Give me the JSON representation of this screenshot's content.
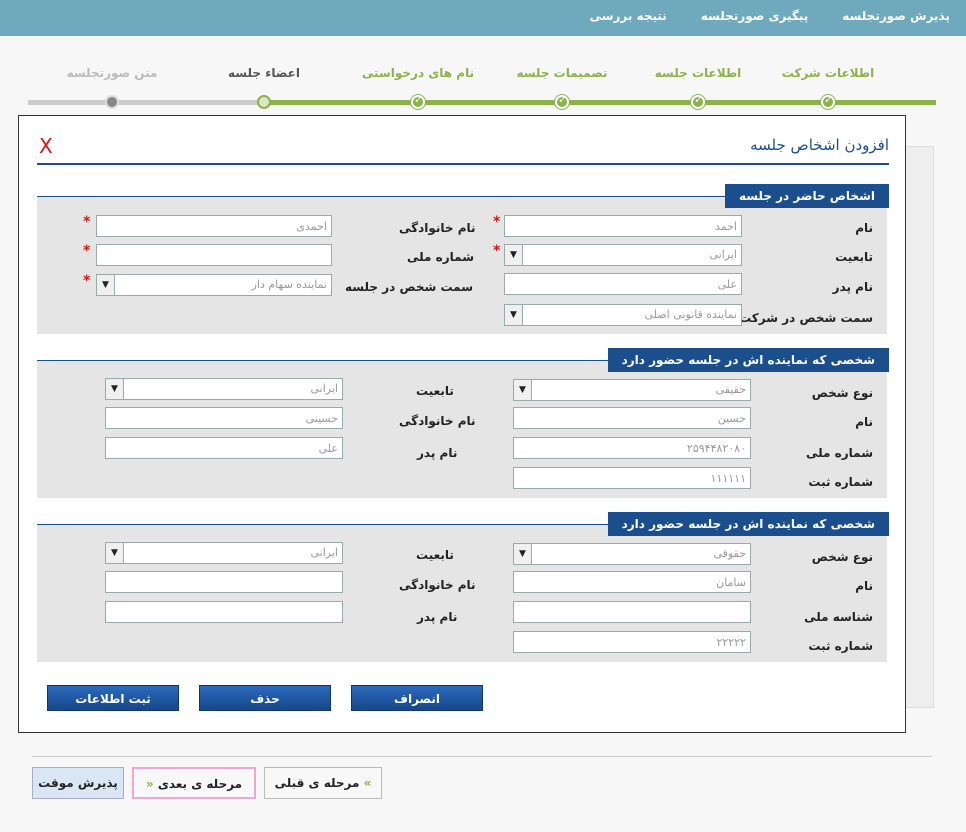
{
  "topnav": {
    "items": [
      "پذیرش صورتجلسه",
      "پیگیری صورتجلسه",
      "نتیجه بررسی"
    ]
  },
  "wizard": {
    "steps": [
      {
        "label": "اطلاعات شرکت",
        "status": "done"
      },
      {
        "label": "اطلاعات جلسه",
        "status": "done"
      },
      {
        "label": "تصمیمات جلسه",
        "status": "done"
      },
      {
        "label": "نام های درخواستی",
        "status": "done"
      },
      {
        "label": "اعضاء جلسه",
        "status": "current"
      },
      {
        "label": "متن صورتجلسه",
        "status": "future"
      }
    ]
  },
  "modal": {
    "title": "افزودن اشخاص جلسه",
    "close": "X",
    "section1": {
      "heading": "اشخاص حاضر در جلسه",
      "name_label": "نام",
      "name_value": "احمد",
      "family_label": "نام خانوادگی",
      "family_value": "احمدی",
      "nationality_label": "تابعیت",
      "nationality_value": "ایرانی",
      "national_id_label": "شماره ملی",
      "national_id_value": "",
      "father_label": "نام پدر",
      "father_value": "علی",
      "role_session_label": "سمت شخص در جلسه",
      "role_session_value": "نماینده سهام دار",
      "role_company_label": "سمت شخص در شرکت",
      "role_company_value": "نماینده قانونی اصلی",
      "required_mark": "*"
    },
    "section2": {
      "heading": "شخصی که نماینده اش در جلسه حضور دارد",
      "person_type_label": "نوع شخص",
      "person_type_value": "حقیقی",
      "nationality_label": "تابعیت",
      "nationality_value": "ایرانی",
      "name_label": "نام",
      "name_value": "حسین",
      "family_label": "نام خانوادگی",
      "family_value": "حسینی",
      "national_id_label": "شماره ملی",
      "national_id_value": "۲۵۹۴۴۸۲۰۸۰",
      "father_label": "نام پدر",
      "father_value": "علی",
      "reg_label": "شماره ثبت",
      "reg_value": "۱۱۱۱۱۱"
    },
    "section3": {
      "heading": "شخصی که نماینده اش در جلسه حضور دارد",
      "person_type_label": "نوع شخص",
      "person_type_value": "حقوقی",
      "nationality_label": "تابعیت",
      "nationality_value": "ایرانی",
      "name_label": "نام",
      "name_value": "سامان",
      "family_label": "نام خانوادگی",
      "family_value": "",
      "national_id_label": "شناسه ملی",
      "national_id_value": "",
      "father_label": "نام پدر",
      "father_value": "",
      "reg_label": "شماره ثبت",
      "reg_value": "۲۲۲۲۲"
    },
    "buttons": {
      "cancel": "انصراف",
      "delete": "حذف",
      "submit": "ثبت اطلاعات"
    }
  },
  "footer": {
    "prev": "مرحله ی قبلی",
    "next": "مرحله ی بعدی",
    "temp_accept": "پذیرش موقت",
    "prev_glyph": "»",
    "next_glyph": "«"
  },
  "colors": {
    "topbar": "#6ea9be",
    "accent_blue": "#1b4e8c",
    "step_done": "#8cb24a",
    "required": "#e01010"
  }
}
